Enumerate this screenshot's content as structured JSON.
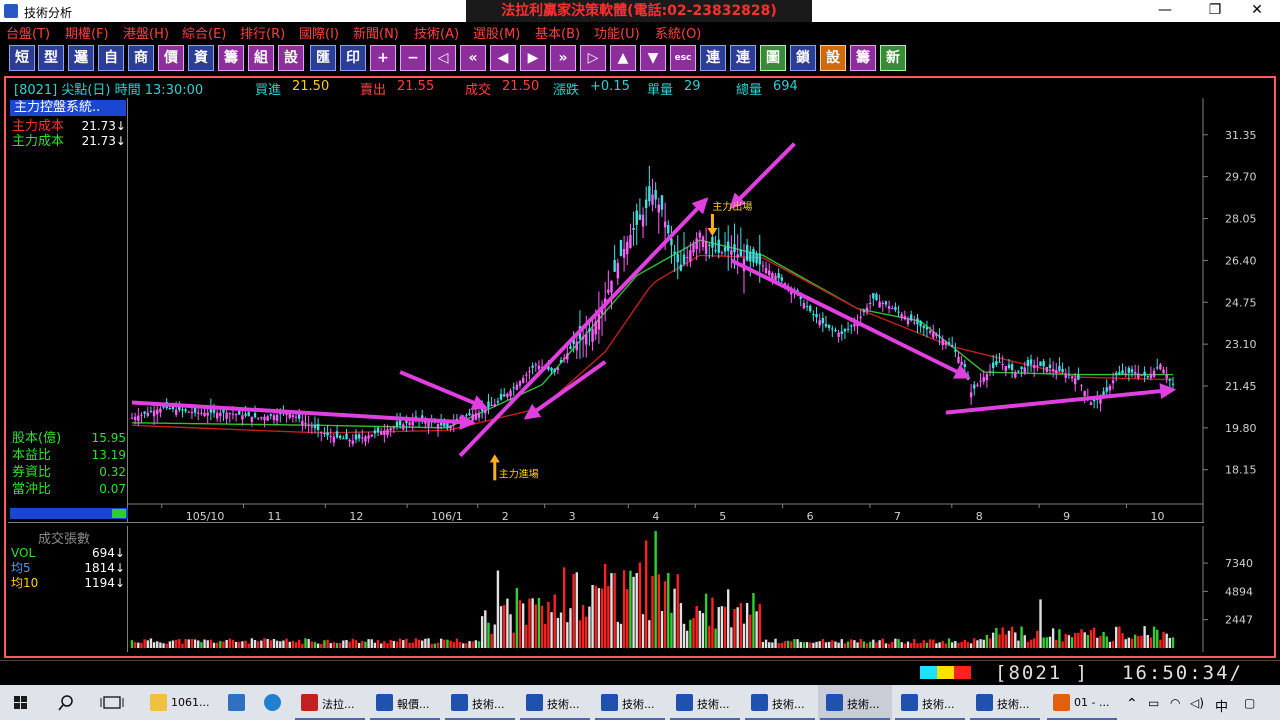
{
  "window": {
    "title": "技術分析",
    "banner": "法拉利贏家決策軟體(電話:02-23832828)",
    "minimize": "—",
    "maximize": "❐",
    "close": "✕"
  },
  "menu": [
    "台盤(T)",
    "期權(F)",
    "港盤(H)",
    "綜合(E)",
    "排行(R)",
    "國際(I)",
    "新聞(N)",
    "技術(A)",
    "選股(M)",
    "基本(B)",
    "功能(U)",
    "系統(O)"
  ],
  "toolbar": [
    "短",
    "型",
    "邏",
    "自",
    "商",
    "價",
    "資",
    "籌",
    "組",
    "設",
    "匯",
    "印",
    "+",
    "−",
    "◁",
    "«",
    "◀",
    "▶",
    "»",
    "▷",
    "▲",
    "▼",
    "esc",
    "連",
    "連",
    "圖",
    "鎖",
    "設",
    "籌",
    "新"
  ],
  "status": {
    "code_time": "[8021] 尖點(日) 時間 13:30:00",
    "bid_label": "買進",
    "bid": "21.50",
    "ask_label": "賣出",
    "ask": "21.55",
    "deal_label": "成交",
    "deal": "21.50",
    "change_label": "漲跌",
    "change": "+0.15",
    "unit_label": "單量",
    "unit": "29",
    "total_label": "總量",
    "total": "694"
  },
  "left_panel": {
    "title": "主力控盤系統..",
    "rows": [
      {
        "label": "主力成本",
        "value": "21.73↓",
        "color": "#ff3030"
      },
      {
        "label": "主力成本",
        "value": "21.73↓",
        "color": "#30e030"
      }
    ],
    "fundamentals": [
      {
        "label": "股本(億)",
        "value": "15.95"
      },
      {
        "label": "本益比",
        "value": "13.19"
      },
      {
        "label": "券資比",
        "value": "0.32"
      },
      {
        "label": "當沖比",
        "value": "0.07"
      }
    ]
  },
  "annotations": {
    "entry": "主力進場",
    "exit": "主力出場"
  },
  "volume_panel": {
    "title": "成交張數",
    "rows": [
      {
        "label": "VOL",
        "value": "694↓",
        "color": "#30e030"
      },
      {
        "label": "均5",
        "value": "1814↓",
        "color": "#4aa0ff"
      },
      {
        "label": "均10",
        "value": "1194↓",
        "color": "#ffd000"
      }
    ]
  },
  "bottom": {
    "code": "[8021  ]",
    "clock": "16:50:34/"
  },
  "taskbar": {
    "items": [
      {
        "label": "1061...",
        "icon": "folder-icon"
      },
      {
        "label": "",
        "icon": "computer-icon"
      },
      {
        "label": "",
        "icon": "ie-icon"
      },
      {
        "label": "法拉...",
        "icon": "ferrari-app-icon"
      },
      {
        "label": "報價...",
        "icon": "chart-app-icon"
      },
      {
        "label": "技術...",
        "icon": "chart-app-icon"
      },
      {
        "label": "技術...",
        "icon": "chart-app-icon"
      },
      {
        "label": "技術...",
        "icon": "chart-app-icon"
      },
      {
        "label": "技術...",
        "icon": "chart-app-icon"
      },
      {
        "label": "技術...",
        "icon": "chart-app-icon"
      },
      {
        "label": "技術...",
        "icon": "chart-app-icon"
      },
      {
        "label": "技術...",
        "icon": "chart-app-icon"
      },
      {
        "label": "技術...",
        "icon": "chart-app-icon"
      },
      {
        "label": "01 - ...",
        "icon": "office-icon"
      }
    ],
    "ime": "中"
  },
  "chart_data": [
    {
      "type": "candlestick",
      "title": "[8021] 尖點(日)",
      "x_ticks": [
        "105/10",
        "11",
        "12",
        "106/1",
        "2",
        "3",
        "4",
        "5",
        "6",
        "7",
        "8",
        "9",
        "10"
      ],
      "y_ticks": [
        31.35,
        29.7,
        28.05,
        26.4,
        24.75,
        23.1,
        21.45,
        19.8,
        18.15
      ],
      "ylim": [
        16.8,
        32.8
      ],
      "close_path": [
        [
          0,
          20.2
        ],
        [
          10,
          20.6
        ],
        [
          20,
          20.4
        ],
        [
          30,
          20.4
        ],
        [
          40,
          20.2
        ],
        [
          50,
          20.4
        ],
        [
          55,
          20.0
        ],
        [
          62,
          19.5
        ],
        [
          70,
          19.3
        ],
        [
          80,
          19.7
        ],
        [
          90,
          20.1
        ],
        [
          96,
          20.0
        ],
        [
          100,
          19.8
        ],
        [
          104,
          20.2
        ],
        [
          110,
          20.4
        ],
        [
          116,
          20.8
        ],
        [
          122,
          21.5
        ],
        [
          128,
          22.3
        ],
        [
          134,
          22.0
        ],
        [
          140,
          23.1
        ],
        [
          146,
          23.7
        ],
        [
          150,
          24.9
        ],
        [
          154,
          26.3
        ],
        [
          158,
          27.4
        ],
        [
          162,
          28.2
        ],
        [
          165,
          29.0
        ],
        [
          168,
          28.4
        ],
        [
          171,
          27.0
        ],
        [
          174,
          26.0
        ],
        [
          177,
          26.8
        ],
        [
          180,
          27.5
        ],
        [
          183,
          27.0
        ],
        [
          186,
          26.7
        ],
        [
          190,
          26.8
        ],
        [
          195,
          26.4
        ],
        [
          200,
          26.2
        ],
        [
          205,
          25.7
        ],
        [
          210,
          25.2
        ],
        [
          215,
          24.4
        ],
        [
          220,
          23.8
        ],
        [
          225,
          23.5
        ],
        [
          230,
          24.0
        ],
        [
          235,
          24.9
        ],
        [
          240,
          24.6
        ],
        [
          245,
          24.2
        ],
        [
          250,
          23.8
        ],
        [
          255,
          23.5
        ],
        [
          260,
          23.0
        ],
        [
          264,
          22.2
        ],
        [
          266,
          21.2
        ],
        [
          270,
          21.8
        ],
        [
          275,
          22.4
        ],
        [
          280,
          22.0
        ],
        [
          285,
          22.3
        ],
        [
          290,
          22.2
        ],
        [
          295,
          22.0
        ],
        [
          300,
          21.7
        ],
        [
          304,
          20.8
        ],
        [
          308,
          21.0
        ],
        [
          312,
          21.9
        ],
        [
          318,
          22.0
        ],
        [
          322,
          21.8
        ],
        [
          326,
          22.3
        ],
        [
          330,
          21.5
        ]
      ],
      "ma_green": [
        [
          0,
          20.0
        ],
        [
          60,
          19.9
        ],
        [
          100,
          19.8
        ],
        [
          130,
          21.5
        ],
        [
          160,
          25.8
        ],
        [
          180,
          27.2
        ],
        [
          200,
          26.6
        ],
        [
          230,
          24.5
        ],
        [
          250,
          24.0
        ],
        [
          270,
          22.0
        ],
        [
          300,
          21.9
        ],
        [
          330,
          21.9
        ]
      ],
      "ma_red": [
        [
          0,
          19.9
        ],
        [
          60,
          19.6
        ],
        [
          100,
          19.7
        ],
        [
          130,
          20.6
        ],
        [
          150,
          22.8
        ],
        [
          165,
          25.5
        ],
        [
          180,
          26.6
        ],
        [
          200,
          26.5
        ],
        [
          230,
          24.5
        ],
        [
          260,
          23.0
        ],
        [
          300,
          21.8
        ],
        [
          330,
          21.7
        ]
      ]
    },
    {
      "type": "bar",
      "title": "成交張數",
      "y_ticks": [
        7340,
        4894,
        2447
      ],
      "ylim": [
        0,
        10200
      ],
      "peaks": [
        {
          "x": 166,
          "value": 10100
        },
        {
          "x": 163,
          "value": 9300
        },
        {
          "x": 116,
          "value": 6700
        },
        {
          "x": 140,
          "value": 6400
        },
        {
          "x": 288,
          "value": 4200
        }
      ]
    }
  ]
}
